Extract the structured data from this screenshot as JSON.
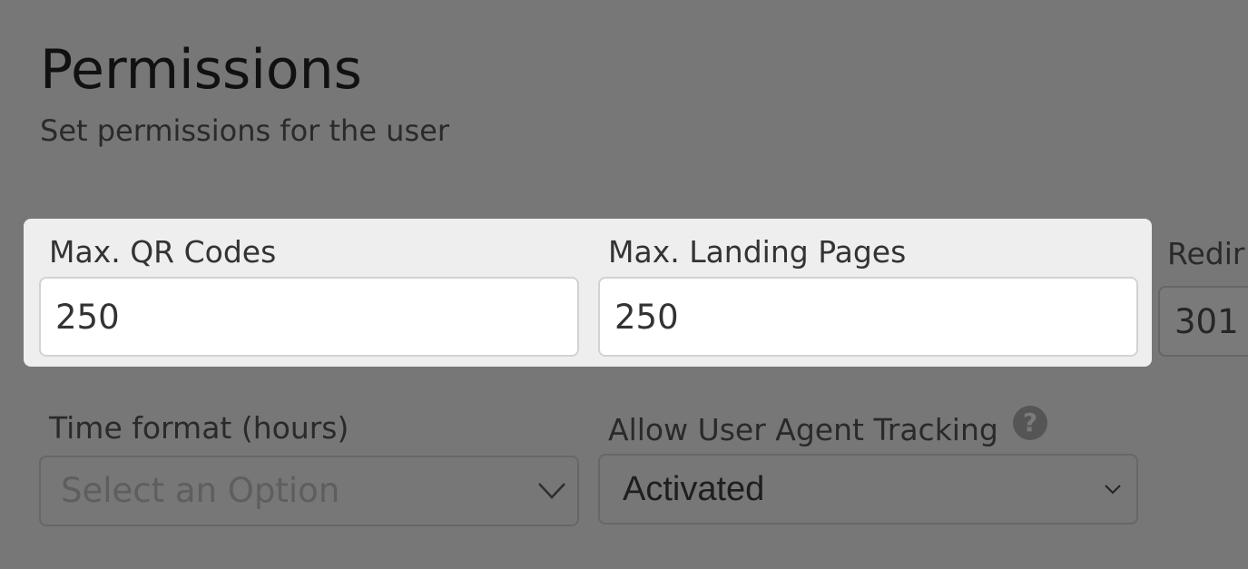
{
  "header": {
    "title": "Permissions",
    "subtitle": "Set permissions for the user"
  },
  "fields": {
    "max_qr_codes": {
      "label": "Max. QR Codes",
      "value": "250"
    },
    "max_landing_pages": {
      "label": "Max. Landing Pages",
      "value": "250"
    },
    "redirect": {
      "label": "Redir",
      "value": "301"
    },
    "time_format": {
      "label": "Time format (hours)",
      "placeholder": "Select an Option"
    },
    "user_agent_tracking": {
      "label": "Allow User Agent Tracking",
      "value": "Activated",
      "help_icon": "question-circle-icon"
    }
  },
  "colors": {
    "overlay": "#777777",
    "highlight_panel": "#eeeeee",
    "input_background": "#ffffff"
  }
}
